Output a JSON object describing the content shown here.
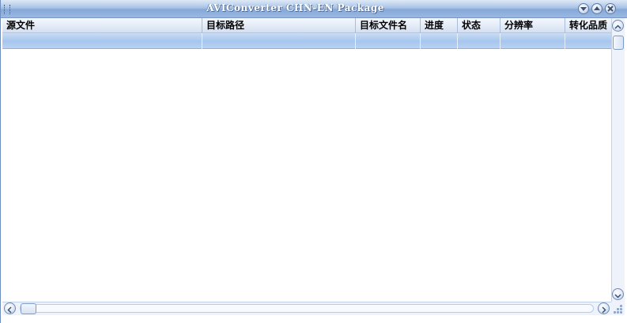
{
  "window": {
    "title": "AVIConverter CHN-EN Package"
  },
  "title_buttons": [
    {
      "name": "minimize",
      "icon": "chevron-down-icon"
    },
    {
      "name": "maximize",
      "icon": "chevron-up-icon"
    },
    {
      "name": "close",
      "icon": "close-icon"
    }
  ],
  "table": {
    "columns": [
      "源文件",
      "目标路径",
      "目标文件名",
      "进度",
      "状态",
      "分辨率",
      "转化品质"
    ],
    "selected_row": [
      "",
      "",
      "",
      "",
      "",
      "",
      ""
    ]
  },
  "colors": {
    "title_gradient_top": "#dfe9f7",
    "title_gradient_bottom": "#86a8d8",
    "header_bg": "#e2eaf6",
    "selection_bg": "#a7c6ee",
    "scrollbar_bg": "#eef3fb"
  }
}
